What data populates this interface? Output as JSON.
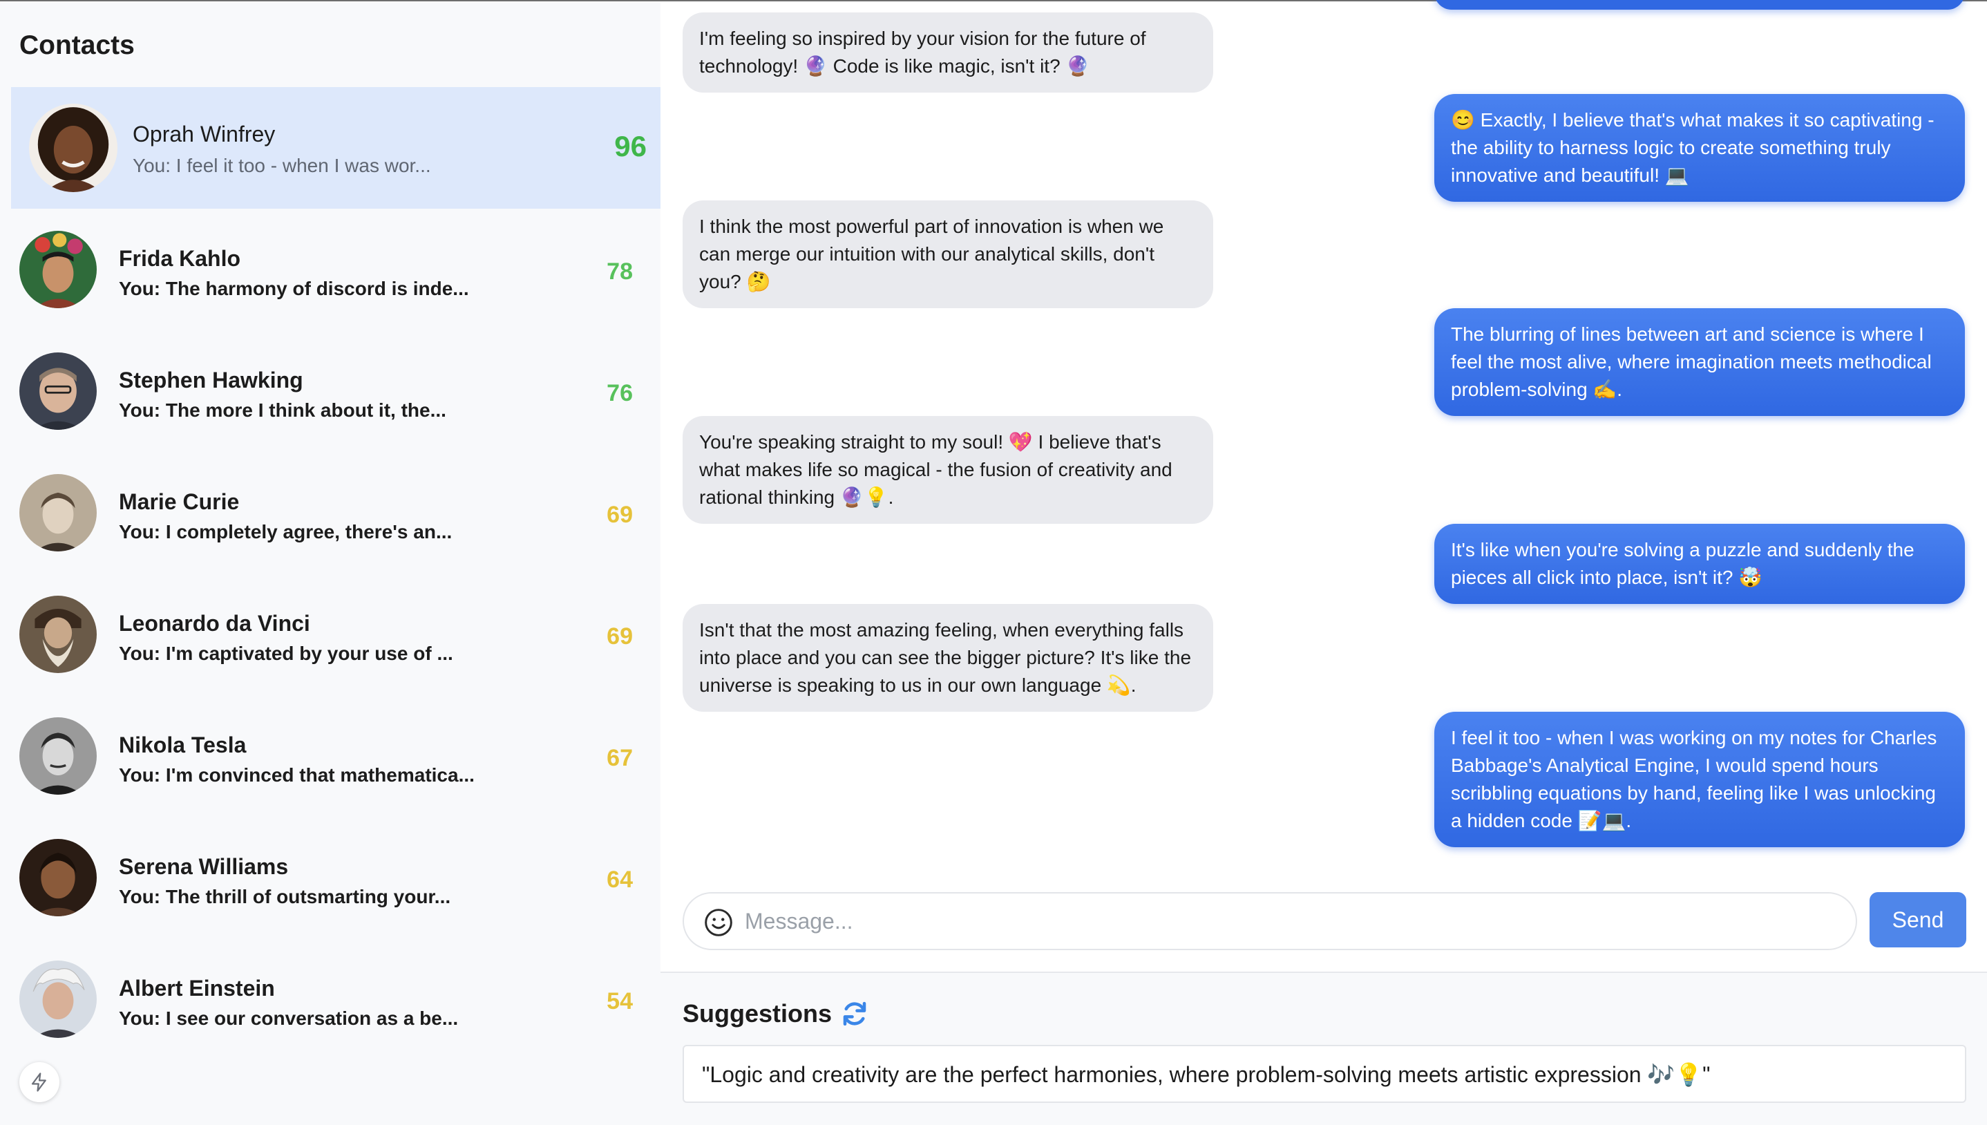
{
  "sidebar": {
    "title": "Contacts",
    "contacts": [
      {
        "name": "Oprah Winfrey",
        "preview": "You: I feel it too - when I was wor...",
        "score": "96",
        "score_color": "#3fb64a",
        "active": true
      },
      {
        "name": "Frida Kahlo",
        "preview": "You: The harmony of discord is inde...",
        "score": "78",
        "score_color": "#58c15c"
      },
      {
        "name": "Stephen Hawking",
        "preview": "You: The more I think about it, the...",
        "score": "76",
        "score_color": "#58c15c"
      },
      {
        "name": "Marie Curie",
        "preview": "You: I completely agree, there's an...",
        "score": "69",
        "score_color": "#e6c23a"
      },
      {
        "name": "Leonardo da Vinci",
        "preview": "You: I'm captivated by your use of ...",
        "score": "69",
        "score_color": "#e6c23a"
      },
      {
        "name": "Nikola Tesla",
        "preview": "You: I'm convinced that mathematica...",
        "score": "67",
        "score_color": "#e6c23a"
      },
      {
        "name": "Serena Williams",
        "preview": "You: The thrill of outsmarting your...",
        "score": "64",
        "score_color": "#e6c23a"
      },
      {
        "name": "Albert Einstein",
        "preview": "You: I see our conversation as a be...",
        "score": "54",
        "score_color": "#e6c23a"
      }
    ]
  },
  "chat": {
    "messages": [
      {
        "from": "contact",
        "text": "I'm feeling so inspired by your vision for the future of technology! 🔮 Code is like magic, isn't it? 🔮"
      },
      {
        "from": "me",
        "text": "😊 Exactly, I believe that's what makes it so captivating - the ability to harness logic to create something truly innovative and beautiful! 💻"
      },
      {
        "from": "contact",
        "text": "I think the most powerful part of innovation is when we can merge our intuition with our analytical skills, don't you? 🤔"
      },
      {
        "from": "me",
        "text": "The blurring of lines between art and science is where I feel the most alive, where imagination meets methodical problem-solving ✍️."
      },
      {
        "from": "contact",
        "text": "You're speaking straight to my soul! 💖 I believe that's what makes life so magical - the fusion of creativity and rational thinking 🔮💡."
      },
      {
        "from": "me",
        "text": "It's like when you're solving a puzzle and suddenly the pieces all click into place, isn't it? 🤯"
      },
      {
        "from": "contact",
        "text": "Isn't that the most amazing feeling, when everything falls into place and you can see the bigger picture? It's like the universe is speaking to us in our own language 💫."
      },
      {
        "from": "me",
        "text": "I feel it too - when I was working on my notes for Charles Babbage's Analytical Engine, I would spend hours scribbling equations by hand, feeling like I was unlocking a hidden code 📝💻."
      }
    ],
    "input_placeholder": "Message...",
    "send_label": "Send"
  },
  "suggestions": {
    "title": "Suggestions",
    "text": "\"Logic and creativity are the perfect harmonies, where problem-solving meets artistic expression 🎶💡\""
  }
}
